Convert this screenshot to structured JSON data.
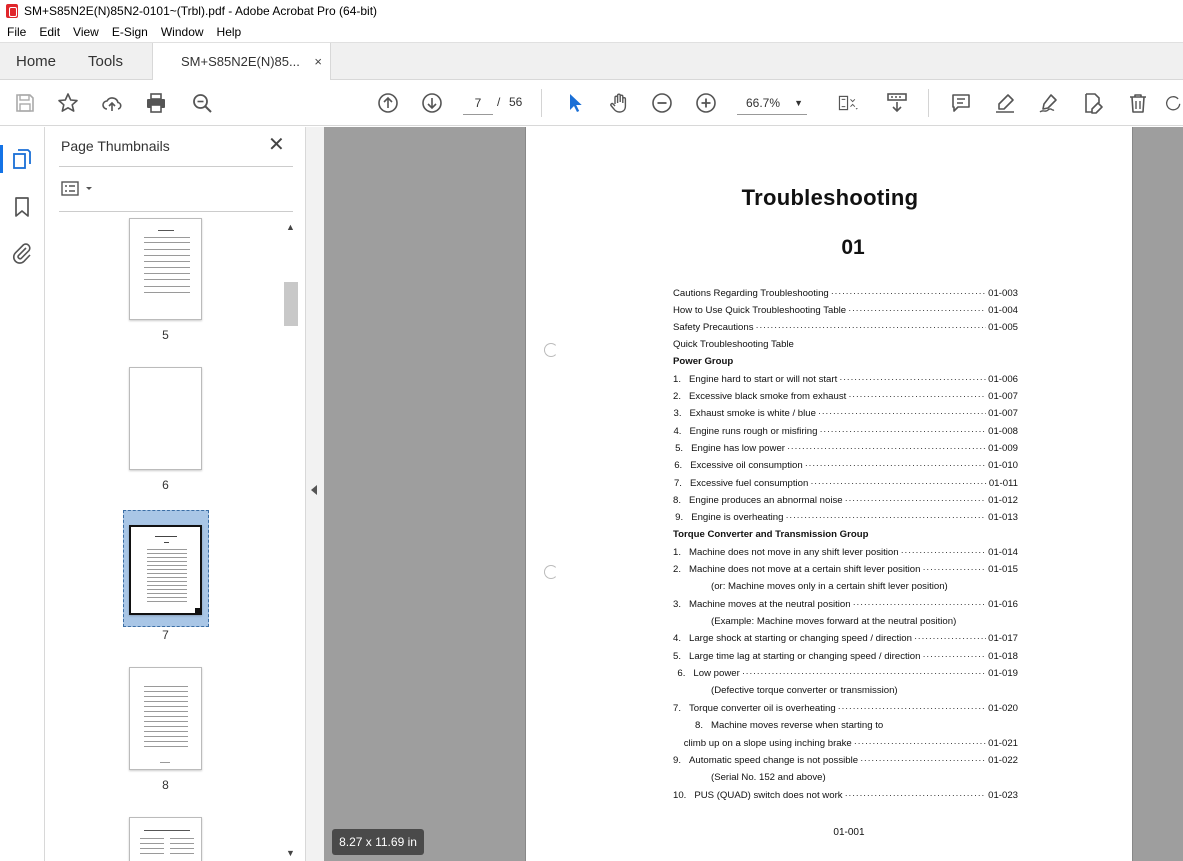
{
  "window": {
    "title": "SM+S85N2E(N)85N2-0101~(Trbl).pdf - Adobe Acrobat Pro (64-bit)"
  },
  "menu": [
    "File",
    "Edit",
    "View",
    "E-Sign",
    "Window",
    "Help"
  ],
  "tabs": {
    "home": "Home",
    "tools": "Tools",
    "document": "SM+S85N2E(N)85...",
    "close": "×"
  },
  "toolbar": {
    "current_page": "7",
    "page_separator": "/",
    "total_pages": "56",
    "zoom": "66.7%",
    "icons": [
      "save-icon",
      "star-icon",
      "upload-icon",
      "print-icon",
      "zoom-search-icon",
      "page-up-icon",
      "page-down-icon",
      "select-arrow-icon",
      "hand-icon",
      "zoom-out-icon",
      "zoom-in-icon",
      "page-fit-icon",
      "scroll-mode-icon",
      "comment-icon",
      "highlight-icon",
      "sign-icon",
      "edit-pdf-icon",
      "delete-icon"
    ]
  },
  "thumbnails": {
    "title": "Page Thumbnails",
    "close": "✕",
    "pages": [
      "5",
      "6",
      "7",
      "8"
    ],
    "selected_page": "7"
  },
  "document": {
    "title": "Troubleshooting",
    "number": "01",
    "entries": [
      {
        "text": "Cautions Regarding Troubleshooting",
        "page": "01-003"
      },
      {
        "text": "How to Use Quick Troubleshooting Table",
        "page": "01-004"
      },
      {
        "text": "Safety Precautions",
        "page": "01-005"
      },
      {
        "text": "Quick Troubleshooting Table",
        "page": ""
      },
      {
        "text": "Power Group",
        "page": "",
        "bold": true
      },
      {
        "num": "1.",
        "text": "Engine hard to start or will not start",
        "page": "01-006"
      },
      {
        "num": "2.",
        "text": "Excessive black smoke from exhaust",
        "page": "01-007"
      },
      {
        "num": "3.",
        "text": "Exhaust smoke is white / blue",
        "page": "01-007"
      },
      {
        "num": "4.",
        "text": "Engine runs rough or misfiring",
        "page": "01-008"
      },
      {
        "num": "5.",
        "text": "Engine has low power",
        "page": "01-009"
      },
      {
        "num": "6.",
        "text": "Excessive oil consumption",
        "page": "01-010"
      },
      {
        "num": "7.",
        "text": "Excessive fuel consumption",
        "page": "01-011"
      },
      {
        "num": "8.",
        "text": "Engine produces an abnormal noise",
        "page": "01-012"
      },
      {
        "num": "9.",
        "text": "Engine is overheating",
        "page": "01-013"
      },
      {
        "text": "Torque Converter and Transmission Group",
        "page": "",
        "bold": true
      },
      {
        "num": "1.",
        "text": "Machine does not move in any shift lever position",
        "page": "01-014"
      },
      {
        "num": "2.",
        "text": "Machine does not move at a certain shift lever position",
        "page": "01-015"
      },
      {
        "text": "(or: Machine moves only in a certain shift lever position)",
        "page": "",
        "cont": true
      },
      {
        "num": "3.",
        "text": "Machine moves at the neutral position",
        "page": "01-016"
      },
      {
        "text": "(Example: Machine moves forward at the neutral position)",
        "page": "",
        "cont": true
      },
      {
        "num": "4.",
        "text": "Large shock at starting or changing speed / direction",
        "page": "01-017"
      },
      {
        "num": "5.",
        "text": "Large time lag at starting or changing speed / direction",
        "page": "01-018"
      },
      {
        "num": "6.",
        "text": "Low power",
        "page": "01-019"
      },
      {
        "text": "(Defective torque converter or transmission)",
        "page": "",
        "cont": true
      },
      {
        "num": "7.",
        "text": "Torque converter oil is overheating",
        "page": "01-020"
      },
      {
        "num": "8.",
        "text": "Machine moves reverse when starting to",
        "page": ""
      },
      {
        "text": "climb up on a slope using inching brake",
        "page": "01-021",
        "cont2": true
      },
      {
        "num": "9.",
        "text": "Automatic speed change is not possible",
        "page": "01-022"
      },
      {
        "text": "(Serial No. 152 and above)",
        "page": "",
        "cont": true
      },
      {
        "num": "10.",
        "text": "PUS (QUAD) switch does not work",
        "page": "01-023"
      }
    ],
    "footer": "01-001"
  },
  "status": {
    "page_size": "8.27 x 11.69 in"
  }
}
